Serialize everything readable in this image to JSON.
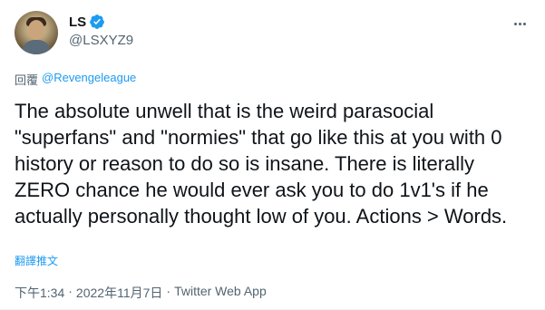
{
  "user": {
    "display_name": "LS",
    "handle": "@LSXYZ9",
    "verified": true
  },
  "reply": {
    "prefix": "回覆",
    "mention": "@Revengeleague"
  },
  "tweet": {
    "text": "The absolute unwell that is the weird parasocial \"superfans\" and \"normies\" that go like this at you with 0 history or reason to do so is insane. There is literally ZERO chance he would ever ask you to do 1v1's if he actually personally thought low of you. Actions > Words.",
    "translate_label": "翻譯推文"
  },
  "meta": {
    "time": "下午1:34",
    "separator1": "·",
    "date": "2022年11月7日",
    "separator2": "·",
    "source": "Twitter Web App"
  },
  "icons": {
    "verified": "verified-badge-icon",
    "more": "more-options-icon"
  },
  "colors": {
    "accent": "#1d9bf0",
    "secondary_text": "#536471",
    "primary_text": "#0f1419"
  }
}
